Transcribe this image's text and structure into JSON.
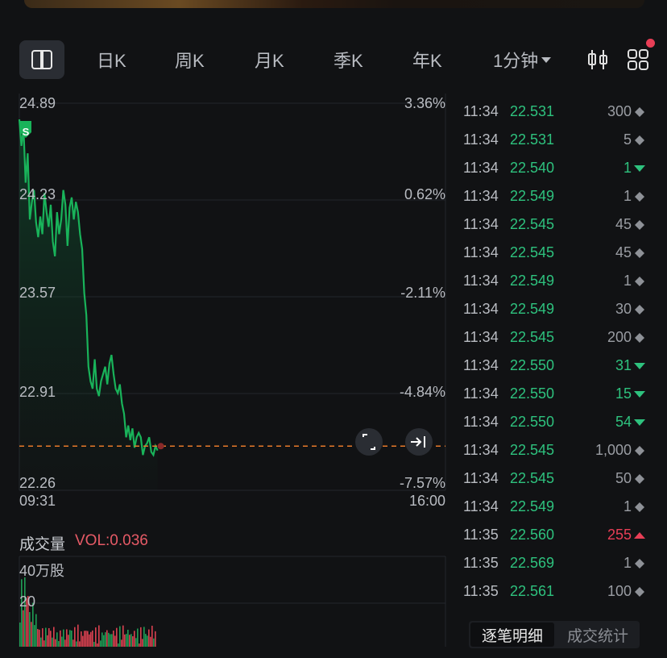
{
  "toolbar": {
    "tabs": [
      {
        "label": "日K"
      },
      {
        "label": "周K"
      },
      {
        "label": "月K"
      },
      {
        "label": "季K"
      },
      {
        "label": "年K"
      }
    ],
    "period_label": "1分钟",
    "icons": [
      "sidebar-toggle-icon",
      "candlestick-icon",
      "grid-apps-icon"
    ],
    "notification_dot_color": "#e83e56"
  },
  "chart": {
    "price_labels": [
      "24.89",
      "24.23",
      "23.57",
      "22.91",
      "22.26"
    ],
    "pct_labels": [
      "3.36%",
      "0.62%",
      "-2.11%",
      "-4.84%",
      "-7.57%"
    ],
    "time_start": "09:31",
    "time_end": "16:00",
    "marker_label": "S",
    "last_price_line_color": "#e8792a",
    "line_color": "#19b35a"
  },
  "chart_data": {
    "type": "line",
    "title": "",
    "xlabel": "",
    "ylabel": "",
    "ylim": [
      22.26,
      24.89
    ],
    "x_range": [
      "09:31",
      "16:00"
    ],
    "reference_price_current": 22.56,
    "series": [
      {
        "values": [
          24.78,
          24.6,
          24.72,
          24.35,
          24.55,
          24.1,
          24.22,
          24.3,
          24.08,
          23.98,
          24.12,
          24.0,
          24.28,
          24.15,
          24.05,
          24.2,
          23.95,
          23.85,
          24.15,
          24.0,
          24.1,
          24.3,
          24.2,
          23.92,
          24.18,
          24.25,
          24.1,
          24.22,
          24.15,
          24.0,
          23.9,
          23.6,
          23.45,
          23.1,
          23.0,
          22.95,
          23.15,
          22.95,
          22.9,
          23.0,
          23.05,
          23.1,
          22.98,
          23.12,
          23.18,
          23.05,
          22.95,
          22.92,
          22.98,
          22.85,
          22.78,
          22.62,
          22.7,
          22.6,
          22.68,
          22.55,
          22.62,
          22.65,
          22.62,
          22.5,
          22.56,
          22.58,
          22.62,
          22.52,
          22.5,
          22.56,
          22.53
        ]
      }
    ]
  },
  "volume": {
    "title": "成交量",
    "value": "VOL:0.036",
    "axis_top": "40万股",
    "axis_mid": "20"
  },
  "trades": [
    {
      "time": "11:34",
      "price": "22.531",
      "vol": "300",
      "dir": "neutral"
    },
    {
      "time": "11:34",
      "price": "22.531",
      "vol": "5",
      "dir": "neutral"
    },
    {
      "time": "11:34",
      "price": "22.540",
      "vol": "1",
      "dir": "buy"
    },
    {
      "time": "11:34",
      "price": "22.549",
      "vol": "1",
      "dir": "neutral"
    },
    {
      "time": "11:34",
      "price": "22.545",
      "vol": "45",
      "dir": "neutral"
    },
    {
      "time": "11:34",
      "price": "22.545",
      "vol": "45",
      "dir": "neutral"
    },
    {
      "time": "11:34",
      "price": "22.549",
      "vol": "1",
      "dir": "neutral"
    },
    {
      "time": "11:34",
      "price": "22.549",
      "vol": "30",
      "dir": "neutral"
    },
    {
      "time": "11:34",
      "price": "22.545",
      "vol": "200",
      "dir": "neutral"
    },
    {
      "time": "11:34",
      "price": "22.550",
      "vol": "31",
      "dir": "buy"
    },
    {
      "time": "11:34",
      "price": "22.550",
      "vol": "15",
      "dir": "buy"
    },
    {
      "time": "11:34",
      "price": "22.550",
      "vol": "54",
      "dir": "buy"
    },
    {
      "time": "11:34",
      "price": "22.545",
      "vol": "1,000",
      "dir": "neutral"
    },
    {
      "time": "11:34",
      "price": "22.545",
      "vol": "50",
      "dir": "neutral"
    },
    {
      "time": "11:34",
      "price": "22.549",
      "vol": "1",
      "dir": "neutral"
    },
    {
      "time": "11:35",
      "price": "22.560",
      "vol": "255",
      "dir": "sell"
    },
    {
      "time": "11:35",
      "price": "22.569",
      "vol": "1",
      "dir": "neutral"
    },
    {
      "time": "11:35",
      "price": "22.561",
      "vol": "100",
      "dir": "neutral"
    }
  ],
  "bottom_tabs": {
    "active": "逐笔明细",
    "inactive": "成交统计"
  }
}
